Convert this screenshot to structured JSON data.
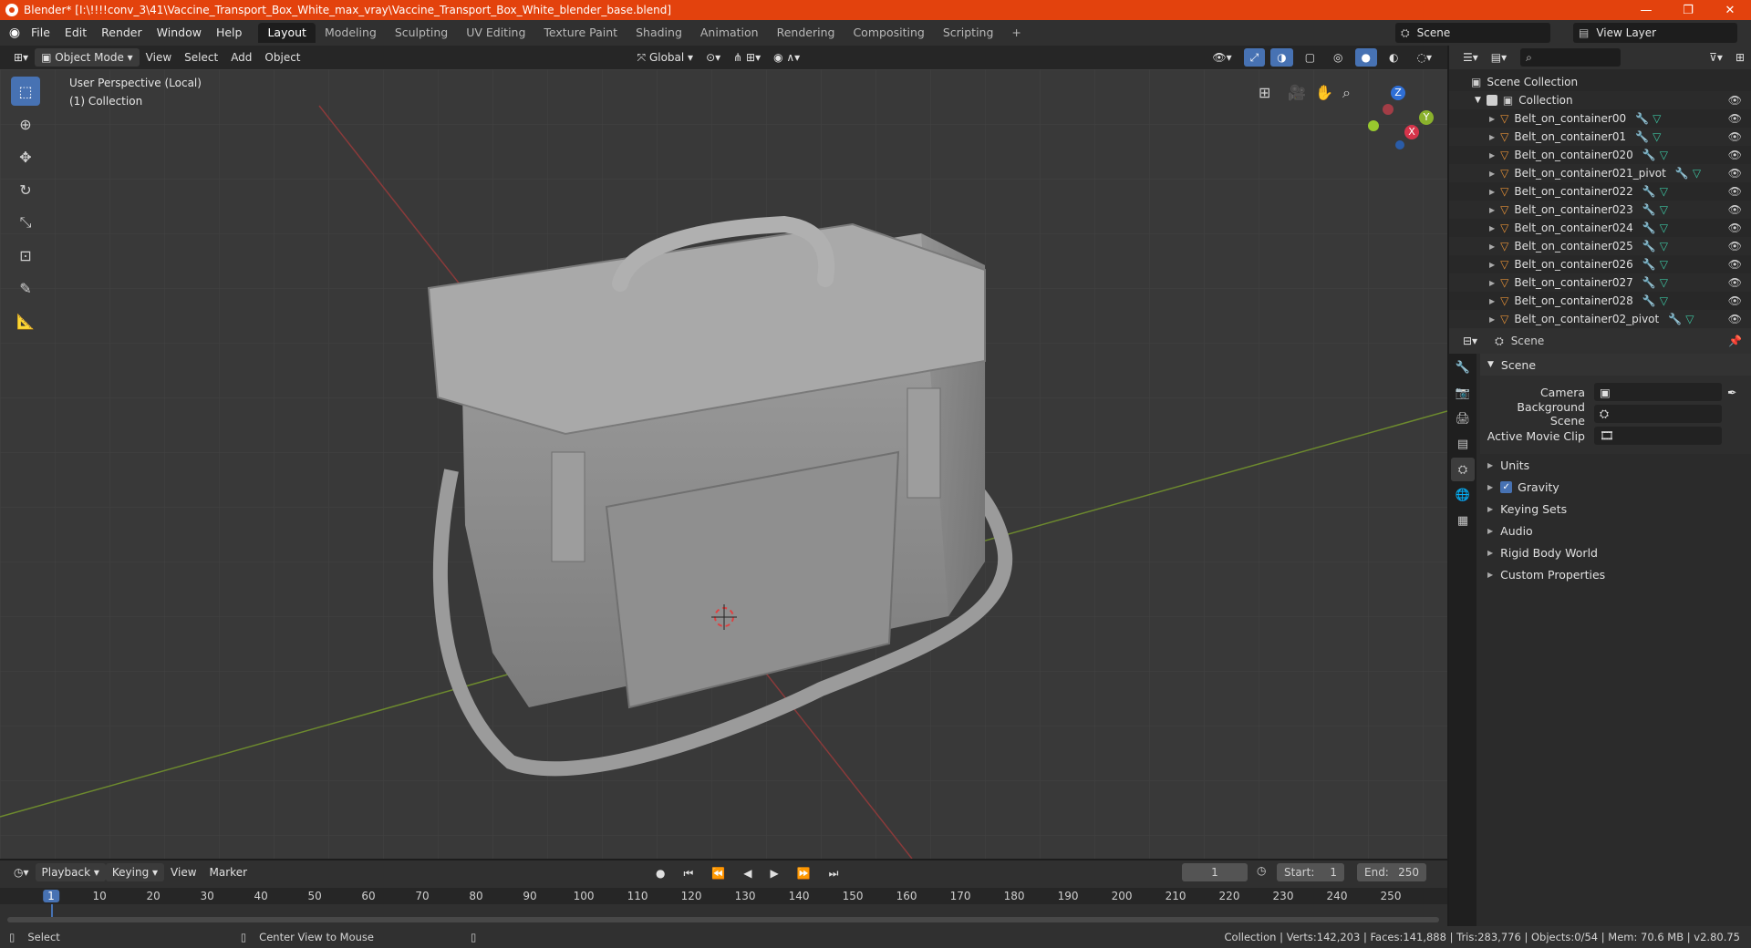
{
  "window": {
    "title": "Blender* [I:\\!!!!conv_3\\41\\Vaccine_Transport_Box_White_max_vray\\Vaccine_Transport_Box_White_blender_base.blend]",
    "min": "—",
    "max": "❐",
    "close": "✕"
  },
  "menu": [
    "File",
    "Edit",
    "Render",
    "Window",
    "Help"
  ],
  "workspaces": [
    "Layout",
    "Modeling",
    "Sculpting",
    "UV Editing",
    "Texture Paint",
    "Shading",
    "Animation",
    "Rendering",
    "Compositing",
    "Scripting"
  ],
  "workspace_add": "+",
  "scene_name": "Scene",
  "view_layer": "View Layer",
  "viewport_header": {
    "mode": "Object Mode",
    "view": "View",
    "select": "Select",
    "add": "Add",
    "object": "Object",
    "transform": "Global"
  },
  "viewport": {
    "perspective": "User Perspective (Local)",
    "collection": "(1) Collection",
    "gizmo_z": "Z",
    "gizmo_y": "Y",
    "gizmo_x": "X"
  },
  "outliner": {
    "scene_collection": "Scene Collection",
    "collection": "Collection",
    "objects": [
      "Belt_on_container00",
      "Belt_on_container01",
      "Belt_on_container020",
      "Belt_on_container021_pivot",
      "Belt_on_container022",
      "Belt_on_container023",
      "Belt_on_container024",
      "Belt_on_container025",
      "Belt_on_container026",
      "Belt_on_container027",
      "Belt_on_container028",
      "Belt_on_container02_pivot"
    ]
  },
  "properties": {
    "context": "Scene",
    "panel": "Scene",
    "camera_label": "Camera",
    "bg_scene_label": "Background Scene",
    "movie_clip_label": "Active Movie Clip",
    "sections": [
      "Units",
      "Gravity",
      "Keying Sets",
      "Audio",
      "Rigid Body World",
      "Custom Properties"
    ]
  },
  "timeline": {
    "playback": "Playback",
    "keying": "Keying",
    "view": "View",
    "marker": "Marker",
    "current_frame": "1",
    "start_label": "Start:",
    "start": "1",
    "end_label": "End:",
    "end": "250",
    "ticks": [
      "1",
      "10",
      "20",
      "30",
      "40",
      "50",
      "60",
      "70",
      "80",
      "90",
      "100",
      "110",
      "120",
      "130",
      "140",
      "150",
      "160",
      "170",
      "180",
      "190",
      "200",
      "210",
      "220",
      "230",
      "240",
      "250"
    ]
  },
  "status": {
    "select": "Select",
    "center_view": "Center View to Mouse",
    "stats": "Collection | Verts:142,203 | Faces:141,888 | Tris:283,776 | Objects:0/54 | Mem: 70.6 MB | v2.80.75"
  }
}
